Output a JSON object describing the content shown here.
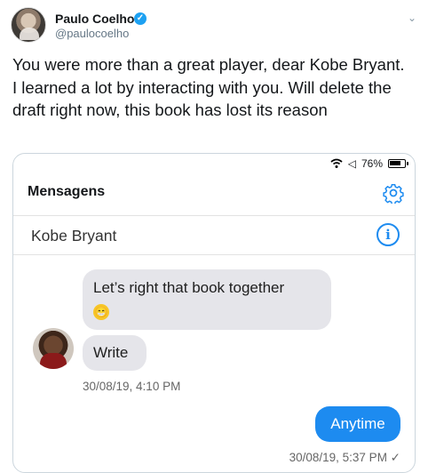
{
  "tweet": {
    "author_name": "Paulo Coelho",
    "author_handle": "@paulocoelho",
    "text": "You were more than a great player, dear Kobe Bryant. I learned a lot by interacting with you. Will delete the draft right now, this book has lost its reason"
  },
  "screenshot": {
    "status": {
      "battery_percent": "76%",
      "signal_text": "◁"
    },
    "header_title": "Mensagens",
    "contact_name": "Kobe Bryant",
    "messages": [
      {
        "text": "Let’s right that book together",
        "emoji": "😁"
      },
      {
        "text": "Write"
      },
      {
        "timestamp": "30/08/19, 4:10 PM"
      },
      {
        "text": "Anytime"
      },
      {
        "timestamp": "30/08/19, 5:37 PM ✓"
      }
    ]
  },
  "icons": [
    "verified-badge-icon",
    "chevron-down-icon",
    "wifi-icon",
    "battery-icon",
    "gear-icon",
    "info-icon",
    "avatar"
  ]
}
